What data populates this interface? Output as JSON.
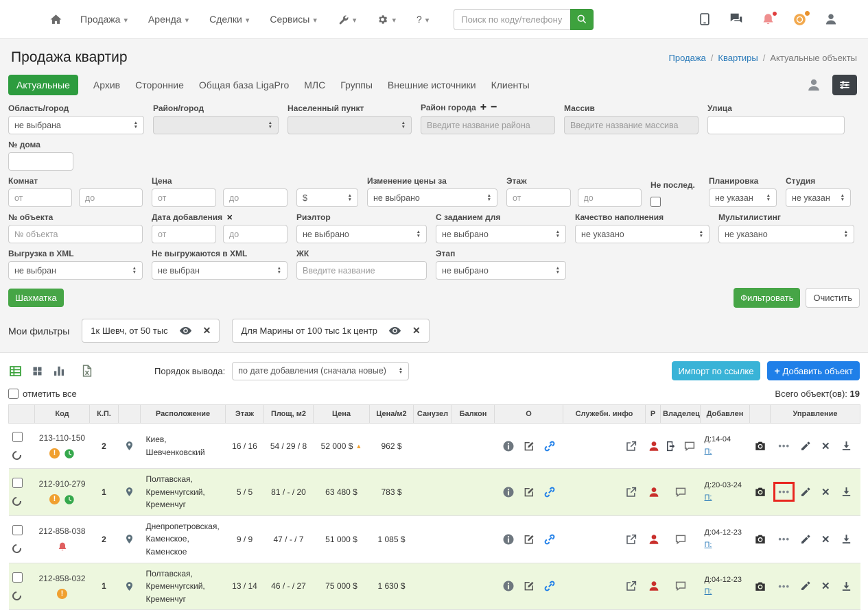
{
  "navbar": {
    "menus": [
      "Продажа",
      "Аренда",
      "Сделки",
      "Сервисы"
    ],
    "help": "?",
    "search_placeholder": "Поиск по коду/телефону"
  },
  "page": {
    "title": "Продажа квартир",
    "breadcrumb": {
      "link1": "Продажа",
      "link2": "Квартиры",
      "current": "Актуальные объекты"
    }
  },
  "tabs": {
    "active": "Актуальные",
    "items": [
      "Архив",
      "Сторонние",
      "Общая база LigaPro",
      "МЛС",
      "Группы",
      "Внешние источники",
      "Клиенты"
    ]
  },
  "filters": {
    "ph_from": "от",
    "ph_to": "до",
    "region": {
      "label": "Область/город",
      "value": "не выбрана"
    },
    "district": {
      "label": "Район/город",
      "value": ""
    },
    "settlement": {
      "label": "Населенный пункт",
      "value": ""
    },
    "city_district": {
      "label": "Район города",
      "placeholder": "Введите название района"
    },
    "massif": {
      "label": "Массив",
      "placeholder": "Введите название массива"
    },
    "street": {
      "label": "Улица"
    },
    "house": {
      "label": "№ дома"
    },
    "rooms": {
      "label": "Комнат"
    },
    "price": {
      "label": "Цена",
      "currency": "$"
    },
    "price_change": {
      "label": "Изменение цены за",
      "value": "не выбрано"
    },
    "floor": {
      "label": "Этаж"
    },
    "not_last": {
      "label": "Не послед."
    },
    "layout": {
      "label": "Планировка",
      "value": "не указан"
    },
    "studio": {
      "label": "Студия",
      "value": "не указан"
    },
    "object_no": {
      "label": "№ объекта",
      "placeholder": "№ объекта"
    },
    "date_added": {
      "label": "Дата добавления"
    },
    "realtor": {
      "label": "Риэлтор",
      "value": "не выбрано"
    },
    "task_for": {
      "label": "С заданием для",
      "value": "не выбрано"
    },
    "quality": {
      "label": "Качество наполнения",
      "value": "не указано"
    },
    "multilisting": {
      "label": "Мультилистинг",
      "value": "не указано"
    },
    "xml_in": {
      "label": "Выгрузка в XML",
      "value": "не выбран"
    },
    "xml_out": {
      "label": "Не выгружаются в XML",
      "value": "не выбран"
    },
    "complex": {
      "label": "ЖК",
      "placeholder": "Введите название"
    },
    "stage": {
      "label": "Этап",
      "value": "не выбрано"
    },
    "chess": "Шахматка",
    "apply": "Фильтровать",
    "clear": "Очистить"
  },
  "my_filters": {
    "label": "Мои фильтры",
    "items": [
      "1к Шевч, от 50 тыс",
      "Для Марины от 100 тыс 1к центр"
    ]
  },
  "toolbar": {
    "sort_label": "Порядок вывода:",
    "sort_value": "по дате добавления (сначала новые)",
    "import": "Импорт по ссылке",
    "add": "Добавить объект"
  },
  "list": {
    "select_all": "отметить все",
    "total_label": "Всего объект(ов):",
    "total": "19"
  },
  "table": {
    "headers": [
      "Код",
      "К.П.",
      "Расположение",
      "Этаж",
      "Площ, м2",
      "Цена",
      "Цена/м2",
      "Санузел",
      "Балкон",
      "О",
      "Служебн. инфо",
      "Р",
      "Владелец",
      "Добавлен",
      "Управление"
    ],
    "rows": [
      {
        "code": "213-110-150",
        "kp": "2",
        "location": "Киев, Шевченковский",
        "floor": "16 / 16",
        "area": "54 / 29 / 8",
        "price": "52 000 $",
        "price_m2": "962 $",
        "added": "Д:14-04",
        "phone_label": "П:"
      },
      {
        "code": "212-910-279",
        "kp": "1",
        "location": "Полтавская, Кременчугский, Кременчуг",
        "floor": "5 / 5",
        "area": "81 / - / 20",
        "price": "63 480 $",
        "price_m2": "783 $",
        "added": "Д:20-03-24",
        "phone_label": "П:"
      },
      {
        "code": "212-858-038",
        "kp": "2",
        "location": "Днепропетровская, Каменское, Каменское",
        "floor": "9 / 9",
        "area": "47 / - / 7",
        "price": "51 000 $",
        "price_m2": "1 085 $",
        "added": "Д:04-12-23",
        "phone_label": "П:"
      },
      {
        "code": "212-858-032",
        "kp": "1",
        "location": "Полтавская, Кременчугский, Кременчуг",
        "floor": "13 / 14",
        "area": "46 / - / 27",
        "price": "75 000 $",
        "price_m2": "1 630 $",
        "added": "Д:04-12-23",
        "phone_label": "П:"
      }
    ]
  },
  "colors": {
    "accent_green": "#2d9c3f",
    "accent_blue": "#1f7fe8",
    "accent_teal": "#39b3d7",
    "highlight_red": "#e8261f",
    "row_green": "#edf7de"
  }
}
